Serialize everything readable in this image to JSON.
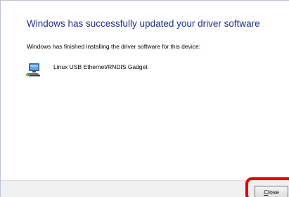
{
  "dialog": {
    "headline": "Windows has successfully updated your driver software",
    "subtitle": "Windows has finished installing the driver software for this device:",
    "device": {
      "name": "Linux USB Ethernet/RNDIS Gadget",
      "icon": "network-adapter-icon"
    }
  },
  "footer": {
    "close_label_mnemonic": "C",
    "close_label_rest": "lose"
  },
  "colors": {
    "headline": "#1e3287",
    "footer_bg": "#f0f0f0",
    "highlight": "#e00000"
  }
}
